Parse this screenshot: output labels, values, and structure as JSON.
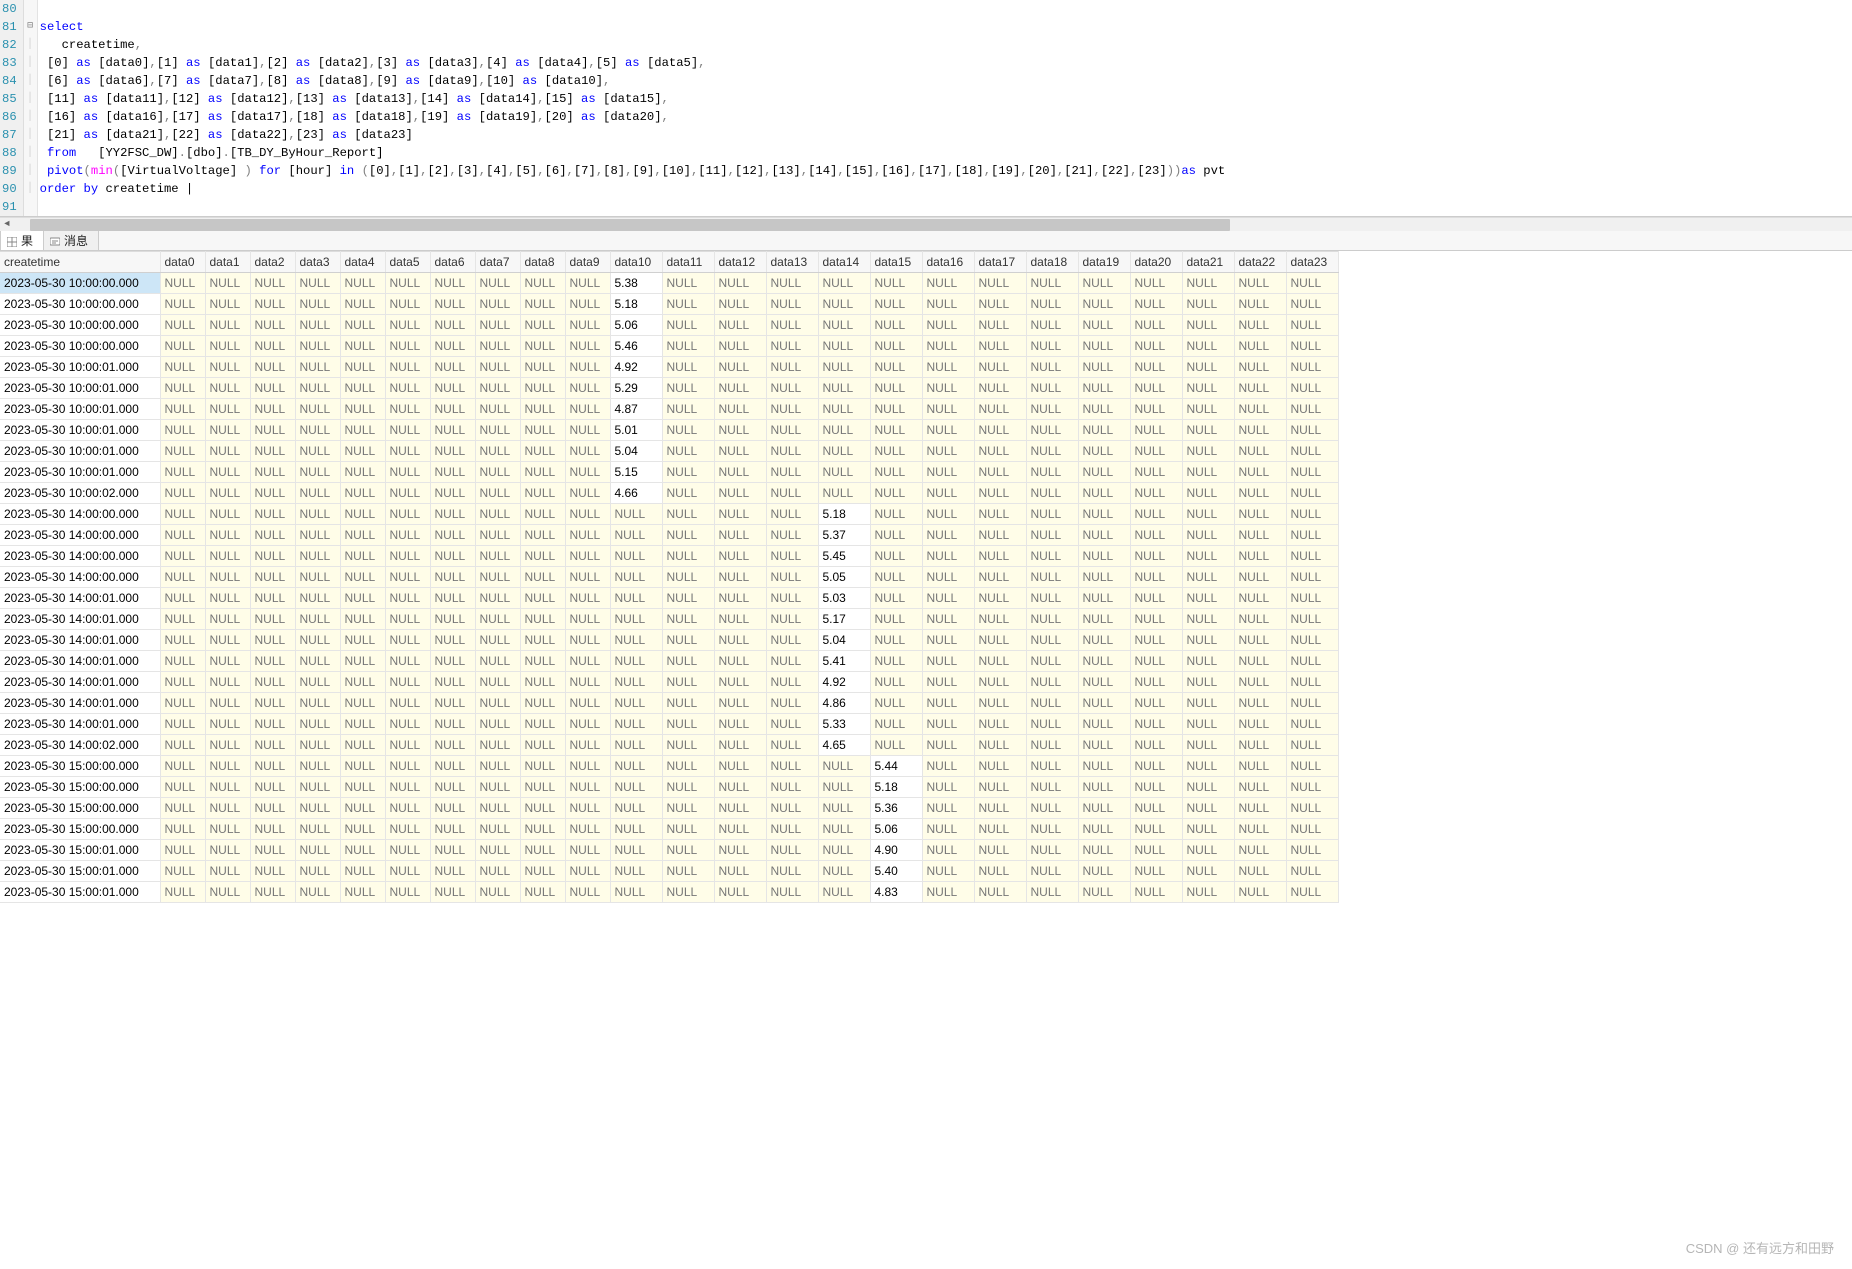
{
  "editor": {
    "line_numbers": [
      80,
      81,
      82,
      83,
      84,
      85,
      86,
      87,
      88,
      89,
      90,
      91
    ],
    "fold_mark_line": 81,
    "tokens": [
      [],
      [
        {
          "t": "select",
          "c": "kw-blue"
        }
      ],
      [
        {
          "t": "  createtime",
          "c": "kw-black"
        },
        {
          "t": ",",
          "c": "kw-gray"
        }
      ],
      [
        {
          "t": "[0] ",
          "c": "kw-black"
        },
        {
          "t": "as",
          "c": "kw-blue"
        },
        {
          "t": " [data0]",
          "c": "kw-black"
        },
        {
          "t": ",",
          "c": "kw-gray"
        },
        {
          "t": "[1] ",
          "c": "kw-black"
        },
        {
          "t": "as",
          "c": "kw-blue"
        },
        {
          "t": " [data1]",
          "c": "kw-black"
        },
        {
          "t": ",",
          "c": "kw-gray"
        },
        {
          "t": "[2] ",
          "c": "kw-black"
        },
        {
          "t": "as",
          "c": "kw-blue"
        },
        {
          "t": " [data2]",
          "c": "kw-black"
        },
        {
          "t": ",",
          "c": "kw-gray"
        },
        {
          "t": "[3] ",
          "c": "kw-black"
        },
        {
          "t": "as",
          "c": "kw-blue"
        },
        {
          "t": " [data3]",
          "c": "kw-black"
        },
        {
          "t": ",",
          "c": "kw-gray"
        },
        {
          "t": "[4] ",
          "c": "kw-black"
        },
        {
          "t": "as",
          "c": "kw-blue"
        },
        {
          "t": " [data4]",
          "c": "kw-black"
        },
        {
          "t": ",",
          "c": "kw-gray"
        },
        {
          "t": "[5] ",
          "c": "kw-black"
        },
        {
          "t": "as",
          "c": "kw-blue"
        },
        {
          "t": " [data5]",
          "c": "kw-black"
        },
        {
          "t": ",",
          "c": "kw-gray"
        }
      ],
      [
        {
          "t": "[6] ",
          "c": "kw-black"
        },
        {
          "t": "as",
          "c": "kw-blue"
        },
        {
          "t": " [data6]",
          "c": "kw-black"
        },
        {
          "t": ",",
          "c": "kw-gray"
        },
        {
          "t": "[7] ",
          "c": "kw-black"
        },
        {
          "t": "as",
          "c": "kw-blue"
        },
        {
          "t": " [data7]",
          "c": "kw-black"
        },
        {
          "t": ",",
          "c": "kw-gray"
        },
        {
          "t": "[8] ",
          "c": "kw-black"
        },
        {
          "t": "as",
          "c": "kw-blue"
        },
        {
          "t": " [data8]",
          "c": "kw-black"
        },
        {
          "t": ",",
          "c": "kw-gray"
        },
        {
          "t": "[9] ",
          "c": "kw-black"
        },
        {
          "t": "as",
          "c": "kw-blue"
        },
        {
          "t": " [data9]",
          "c": "kw-black"
        },
        {
          "t": ",",
          "c": "kw-gray"
        },
        {
          "t": "[10] ",
          "c": "kw-black"
        },
        {
          "t": "as",
          "c": "kw-blue"
        },
        {
          "t": " [data10]",
          "c": "kw-black"
        },
        {
          "t": ",",
          "c": "kw-gray"
        }
      ],
      [
        {
          "t": "[11] ",
          "c": "kw-black"
        },
        {
          "t": "as",
          "c": "kw-blue"
        },
        {
          "t": " [data11]",
          "c": "kw-black"
        },
        {
          "t": ",",
          "c": "kw-gray"
        },
        {
          "t": "[12] ",
          "c": "kw-black"
        },
        {
          "t": "as",
          "c": "kw-blue"
        },
        {
          "t": " [data12]",
          "c": "kw-black"
        },
        {
          "t": ",",
          "c": "kw-gray"
        },
        {
          "t": "[13] ",
          "c": "kw-black"
        },
        {
          "t": "as",
          "c": "kw-blue"
        },
        {
          "t": " [data13]",
          "c": "kw-black"
        },
        {
          "t": ",",
          "c": "kw-gray"
        },
        {
          "t": "[14] ",
          "c": "kw-black"
        },
        {
          "t": "as",
          "c": "kw-blue"
        },
        {
          "t": " [data14]",
          "c": "kw-black"
        },
        {
          "t": ",",
          "c": "kw-gray"
        },
        {
          "t": "[15] ",
          "c": "kw-black"
        },
        {
          "t": "as",
          "c": "kw-blue"
        },
        {
          "t": " [data15]",
          "c": "kw-black"
        },
        {
          "t": ",",
          "c": "kw-gray"
        }
      ],
      [
        {
          "t": "[16] ",
          "c": "kw-black"
        },
        {
          "t": "as",
          "c": "kw-blue"
        },
        {
          "t": " [data16]",
          "c": "kw-black"
        },
        {
          "t": ",",
          "c": "kw-gray"
        },
        {
          "t": "[17] ",
          "c": "kw-black"
        },
        {
          "t": "as",
          "c": "kw-blue"
        },
        {
          "t": " [data17]",
          "c": "kw-black"
        },
        {
          "t": ",",
          "c": "kw-gray"
        },
        {
          "t": "[18] ",
          "c": "kw-black"
        },
        {
          "t": "as",
          "c": "kw-blue"
        },
        {
          "t": " [data18]",
          "c": "kw-black"
        },
        {
          "t": ",",
          "c": "kw-gray"
        },
        {
          "t": "[19] ",
          "c": "kw-black"
        },
        {
          "t": "as",
          "c": "kw-blue"
        },
        {
          "t": " [data19]",
          "c": "kw-black"
        },
        {
          "t": ",",
          "c": "kw-gray"
        },
        {
          "t": "[20] ",
          "c": "kw-black"
        },
        {
          "t": "as",
          "c": "kw-blue"
        },
        {
          "t": " [data20]",
          "c": "kw-black"
        },
        {
          "t": ",",
          "c": "kw-gray"
        }
      ],
      [
        {
          "t": "[21] ",
          "c": "kw-black"
        },
        {
          "t": "as",
          "c": "kw-blue"
        },
        {
          "t": " [data21]",
          "c": "kw-black"
        },
        {
          "t": ",",
          "c": "kw-gray"
        },
        {
          "t": "[22] ",
          "c": "kw-black"
        },
        {
          "t": "as",
          "c": "kw-blue"
        },
        {
          "t": " [data22]",
          "c": "kw-black"
        },
        {
          "t": ",",
          "c": "kw-gray"
        },
        {
          "t": "[23] ",
          "c": "kw-black"
        },
        {
          "t": "as",
          "c": "kw-blue"
        },
        {
          "t": " [data23]",
          "c": "kw-black"
        }
      ],
      [
        {
          "t": "from  ",
          "c": "kw-blue"
        },
        {
          "t": " [YY2FSC_DW]",
          "c": "kw-black"
        },
        {
          "t": ".",
          "c": "kw-gray"
        },
        {
          "t": "[dbo]",
          "c": "kw-black"
        },
        {
          "t": ".",
          "c": "kw-gray"
        },
        {
          "t": "[TB_DY_ByHour_Report]",
          "c": "kw-black"
        }
      ],
      [
        {
          "t": "pivot",
          "c": "kw-blue"
        },
        {
          "t": "(",
          "c": "kw-gray"
        },
        {
          "t": "min",
          "c": "kw-pink"
        },
        {
          "t": "(",
          "c": "kw-gray"
        },
        {
          "t": "[VirtualVoltage] ",
          "c": "kw-black"
        },
        {
          "t": ")",
          "c": "kw-gray"
        },
        {
          "t": " for ",
          "c": "kw-blue"
        },
        {
          "t": "[hour] ",
          "c": "kw-black"
        },
        {
          "t": "in ",
          "c": "kw-blue"
        },
        {
          "t": "(",
          "c": "kw-gray"
        },
        {
          "t": "[0]",
          "c": "kw-black"
        },
        {
          "t": ",",
          "c": "kw-gray"
        },
        {
          "t": "[1]",
          "c": "kw-black"
        },
        {
          "t": ",",
          "c": "kw-gray"
        },
        {
          "t": "[2]",
          "c": "kw-black"
        },
        {
          "t": ",",
          "c": "kw-gray"
        },
        {
          "t": "[3]",
          "c": "kw-black"
        },
        {
          "t": ",",
          "c": "kw-gray"
        },
        {
          "t": "[4]",
          "c": "kw-black"
        },
        {
          "t": ",",
          "c": "kw-gray"
        },
        {
          "t": "[5]",
          "c": "kw-black"
        },
        {
          "t": ",",
          "c": "kw-gray"
        },
        {
          "t": "[6]",
          "c": "kw-black"
        },
        {
          "t": ",",
          "c": "kw-gray"
        },
        {
          "t": "[7]",
          "c": "kw-black"
        },
        {
          "t": ",",
          "c": "kw-gray"
        },
        {
          "t": "[8]",
          "c": "kw-black"
        },
        {
          "t": ",",
          "c": "kw-gray"
        },
        {
          "t": "[9]",
          "c": "kw-black"
        },
        {
          "t": ",",
          "c": "kw-gray"
        },
        {
          "t": "[10]",
          "c": "kw-black"
        },
        {
          "t": ",",
          "c": "kw-gray"
        },
        {
          "t": "[11]",
          "c": "kw-black"
        },
        {
          "t": ",",
          "c": "kw-gray"
        },
        {
          "t": "[12]",
          "c": "kw-black"
        },
        {
          "t": ",",
          "c": "kw-gray"
        },
        {
          "t": "[13]",
          "c": "kw-black"
        },
        {
          "t": ",",
          "c": "kw-gray"
        },
        {
          "t": "[14]",
          "c": "kw-black"
        },
        {
          "t": ",",
          "c": "kw-gray"
        },
        {
          "t": "[15]",
          "c": "kw-black"
        },
        {
          "t": ",",
          "c": "kw-gray"
        },
        {
          "t": "[16]",
          "c": "kw-black"
        },
        {
          "t": ",",
          "c": "kw-gray"
        },
        {
          "t": "[17]",
          "c": "kw-black"
        },
        {
          "t": ",",
          "c": "kw-gray"
        },
        {
          "t": "[18]",
          "c": "kw-black"
        },
        {
          "t": ",",
          "c": "kw-gray"
        },
        {
          "t": "[19]",
          "c": "kw-black"
        },
        {
          "t": ",",
          "c": "kw-gray"
        },
        {
          "t": "[20]",
          "c": "kw-black"
        },
        {
          "t": ",",
          "c": "kw-gray"
        },
        {
          "t": "[21]",
          "c": "kw-black"
        },
        {
          "t": ",",
          "c": "kw-gray"
        },
        {
          "t": "[22]",
          "c": "kw-black"
        },
        {
          "t": ",",
          "c": "kw-gray"
        },
        {
          "t": "[23]",
          "c": "kw-black"
        },
        {
          "t": "))",
          "c": "kw-gray"
        },
        {
          "t": "as ",
          "c": "kw-blue"
        },
        {
          "t": "pvt",
          "c": "kw-black"
        }
      ],
      [
        {
          "t": "order by ",
          "c": "kw-blue"
        },
        {
          "t": "createtime ",
          "c": "kw-black"
        },
        {
          "t": "|",
          "c": "kw-black"
        }
      ],
      []
    ]
  },
  "tabs": {
    "results_label": "果",
    "messages_label": "消息"
  },
  "grid": {
    "null_text": "NULL",
    "columns": [
      "createtime",
      "data0",
      "data1",
      "data2",
      "data3",
      "data4",
      "data5",
      "data6",
      "data7",
      "data8",
      "data9",
      "data10",
      "data11",
      "data12",
      "data13",
      "data14",
      "data15",
      "data16",
      "data17",
      "data18",
      "data19",
      "data20",
      "data21",
      "data22",
      "data23"
    ],
    "rows": [
      {
        "createtime": "2023-05-30 10:00:00.000",
        "values": {
          "10": "5.38"
        }
      },
      {
        "createtime": "2023-05-30 10:00:00.000",
        "values": {
          "10": "5.18"
        }
      },
      {
        "createtime": "2023-05-30 10:00:00.000",
        "values": {
          "10": "5.06"
        }
      },
      {
        "createtime": "2023-05-30 10:00:00.000",
        "values": {
          "10": "5.46"
        }
      },
      {
        "createtime": "2023-05-30 10:00:01.000",
        "values": {
          "10": "4.92"
        }
      },
      {
        "createtime": "2023-05-30 10:00:01.000",
        "values": {
          "10": "5.29"
        }
      },
      {
        "createtime": "2023-05-30 10:00:01.000",
        "values": {
          "10": "4.87"
        }
      },
      {
        "createtime": "2023-05-30 10:00:01.000",
        "values": {
          "10": "5.01"
        }
      },
      {
        "createtime": "2023-05-30 10:00:01.000",
        "values": {
          "10": "5.04"
        }
      },
      {
        "createtime": "2023-05-30 10:00:01.000",
        "values": {
          "10": "5.15"
        }
      },
      {
        "createtime": "2023-05-30 10:00:02.000",
        "values": {
          "10": "4.66"
        }
      },
      {
        "createtime": "2023-05-30 14:00:00.000",
        "values": {
          "14": "5.18"
        }
      },
      {
        "createtime": "2023-05-30 14:00:00.000",
        "values": {
          "14": "5.37"
        }
      },
      {
        "createtime": "2023-05-30 14:00:00.000",
        "values": {
          "14": "5.45"
        }
      },
      {
        "createtime": "2023-05-30 14:00:00.000",
        "values": {
          "14": "5.05"
        }
      },
      {
        "createtime": "2023-05-30 14:00:01.000",
        "values": {
          "14": "5.03"
        }
      },
      {
        "createtime": "2023-05-30 14:00:01.000",
        "values": {
          "14": "5.17"
        }
      },
      {
        "createtime": "2023-05-30 14:00:01.000",
        "values": {
          "14": "5.04"
        }
      },
      {
        "createtime": "2023-05-30 14:00:01.000",
        "values": {
          "14": "5.41"
        }
      },
      {
        "createtime": "2023-05-30 14:00:01.000",
        "values": {
          "14": "4.92"
        }
      },
      {
        "createtime": "2023-05-30 14:00:01.000",
        "values": {
          "14": "4.86"
        }
      },
      {
        "createtime": "2023-05-30 14:00:01.000",
        "values": {
          "14": "5.33"
        }
      },
      {
        "createtime": "2023-05-30 14:00:02.000",
        "values": {
          "14": "4.65"
        }
      },
      {
        "createtime": "2023-05-30 15:00:00.000",
        "values": {
          "15": "5.44"
        }
      },
      {
        "createtime": "2023-05-30 15:00:00.000",
        "values": {
          "15": "5.18"
        }
      },
      {
        "createtime": "2023-05-30 15:00:00.000",
        "values": {
          "15": "5.36"
        }
      },
      {
        "createtime": "2023-05-30 15:00:00.000",
        "values": {
          "15": "5.06"
        }
      },
      {
        "createtime": "2023-05-30 15:00:01.000",
        "values": {
          "15": "4.90"
        }
      },
      {
        "createtime": "2023-05-30 15:00:01.000",
        "values": {
          "15": "5.40"
        }
      },
      {
        "createtime": "2023-05-30 15:00:01.000",
        "values": {
          "15": "4.83"
        }
      }
    ]
  },
  "watermark": "CSDN @ 还有远方和田野"
}
